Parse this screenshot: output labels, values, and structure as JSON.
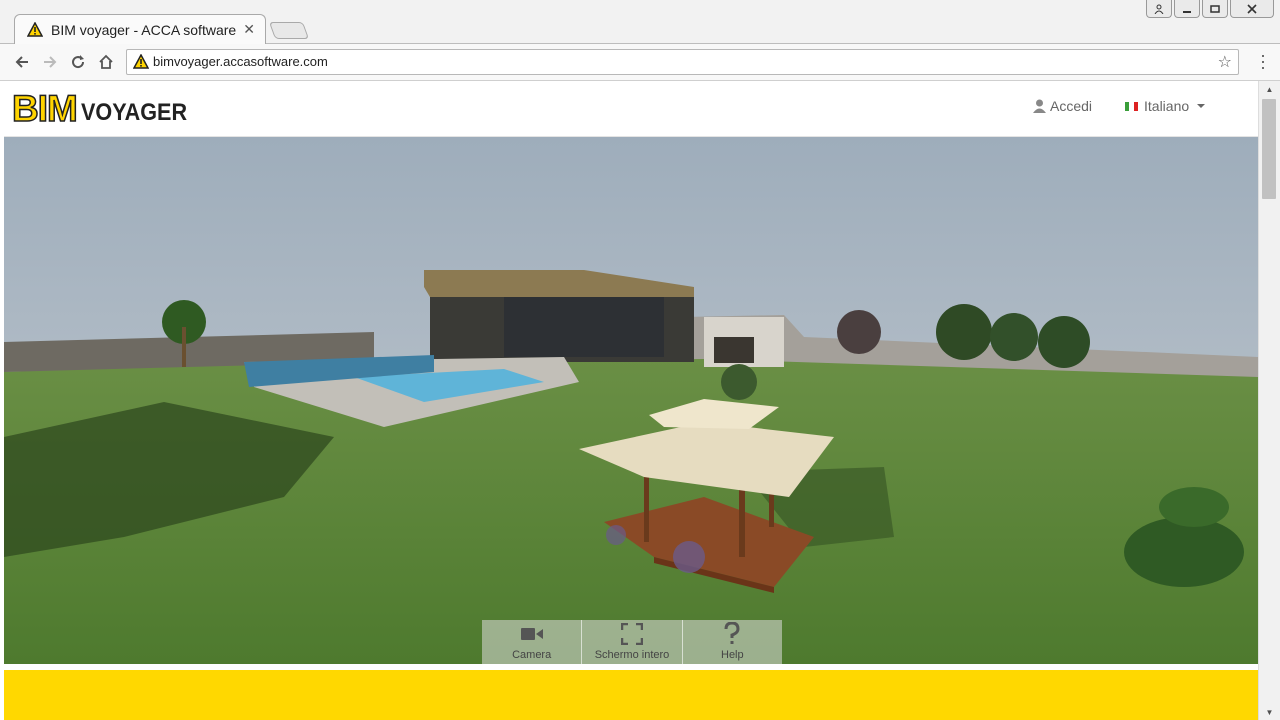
{
  "browser": {
    "tab_title": "BIM voyager - ACCA software",
    "url": "bimvoyager.accasoftware.com"
  },
  "header": {
    "logo_bim": "BIM",
    "logo_voyager": "VOYAGER",
    "login_label": "Accedi",
    "language_label": "Italiano"
  },
  "viewer": {
    "toolbar": [
      {
        "label": "Camera",
        "icon": "video-camera-icon"
      },
      {
        "label": "Schermo intero",
        "icon": "fullscreen-icon"
      },
      {
        "label": "Help",
        "icon": "question-icon"
      }
    ]
  },
  "colors": {
    "brand_yellow": "#ffd800",
    "sky": "#9eacba",
    "grass": "#5f8a3a"
  }
}
